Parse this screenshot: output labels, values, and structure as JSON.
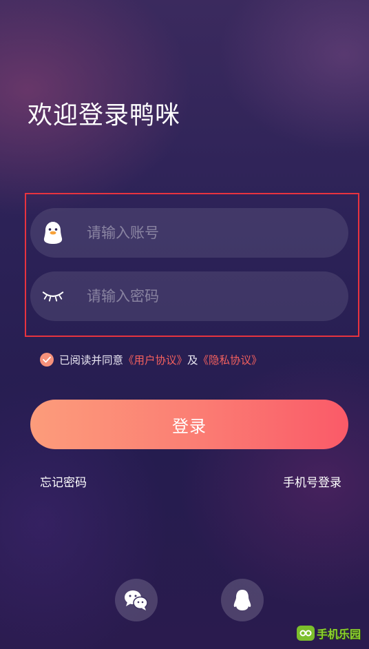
{
  "title": "欢迎登录鸭咪",
  "account_field": {
    "placeholder": "请输入账号",
    "value": "",
    "icon": "duck-icon"
  },
  "password_field": {
    "placeholder": "请输入密码",
    "value": "",
    "icon": "eye-closed-icon"
  },
  "agreement": {
    "checked": true,
    "prefix": "已阅读并同意 ",
    "user_agreement": "《用户协议》",
    "conjunction": "及",
    "privacy_policy": "《隐私协议》"
  },
  "login_button": "登录",
  "forgot_password": "忘记密码",
  "phone_login": "手机号登录",
  "social_login": [
    {
      "name": "wechat",
      "icon": "wechat-icon"
    },
    {
      "name": "qq",
      "icon": "qq-penguin-icon"
    }
  ],
  "watermark": "手机乐园",
  "colors": {
    "accent_start": "#fc9c7b",
    "accent_end": "#fa5a68",
    "link": "#f4605e",
    "highlight_box": "#e8333f"
  }
}
